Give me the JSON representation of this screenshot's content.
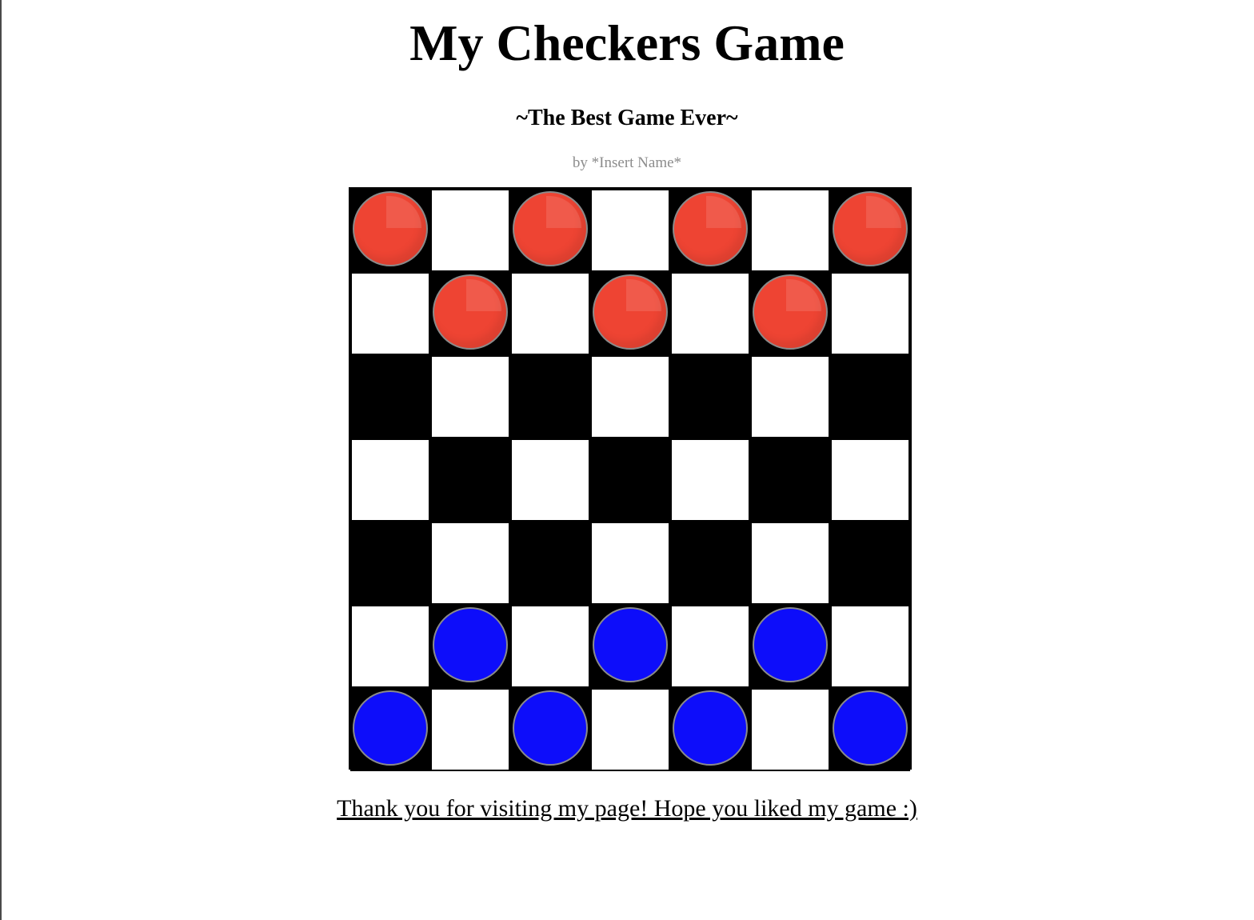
{
  "header": {
    "title": "My Checkers Game",
    "subtitle": "~The Best Game Ever~",
    "author": "by *Insert Name*"
  },
  "board": {
    "rows": 7,
    "cols": 7,
    "light_color": "#ffffff",
    "dark_color": "#000000",
    "pieces": [
      {
        "row": 0,
        "col": 0,
        "color": "red"
      },
      {
        "row": 0,
        "col": 2,
        "color": "red"
      },
      {
        "row": 0,
        "col": 4,
        "color": "red"
      },
      {
        "row": 0,
        "col": 6,
        "color": "red"
      },
      {
        "row": 1,
        "col": 1,
        "color": "red"
      },
      {
        "row": 1,
        "col": 3,
        "color": "red"
      },
      {
        "row": 1,
        "col": 5,
        "color": "red"
      },
      {
        "row": 5,
        "col": 1,
        "color": "blue"
      },
      {
        "row": 5,
        "col": 3,
        "color": "blue"
      },
      {
        "row": 5,
        "col": 5,
        "color": "blue"
      },
      {
        "row": 6,
        "col": 0,
        "color": "blue"
      },
      {
        "row": 6,
        "col": 2,
        "color": "blue"
      },
      {
        "row": 6,
        "col": 4,
        "color": "blue"
      },
      {
        "row": 6,
        "col": 6,
        "color": "blue"
      }
    ],
    "piece_colors": {
      "red": "#ee4433",
      "blue": "#0d0dfa"
    }
  },
  "footer": {
    "link_text": "Thank you for visiting my page! Hope you liked my game :)"
  }
}
